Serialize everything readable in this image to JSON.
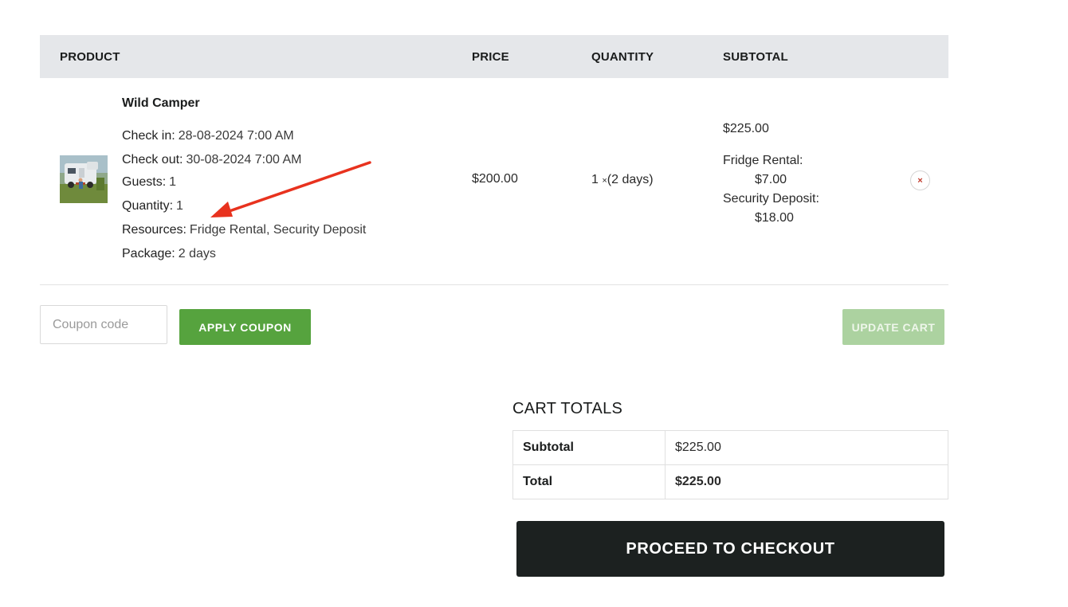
{
  "table": {
    "headers": {
      "product": "PRODUCT",
      "price": "PRICE",
      "quantity": "QUANTITY",
      "subtotal": "SUBTOTAL"
    }
  },
  "item": {
    "name": "Wild Camper",
    "meta": [
      {
        "key": "Check in:",
        "value": "28-08-2024 7:00 AM"
      },
      {
        "key": "Check out:",
        "value": "30-08-2024 7:00 AM"
      },
      {
        "key": "Guests:",
        "value": "1"
      },
      {
        "key": "Quantity:",
        "value": "1"
      },
      {
        "key": "Resources:",
        "value": "Fridge Rental, Security Deposit"
      },
      {
        "key": "Package:",
        "value": "2 days"
      }
    ],
    "price": "$200.00",
    "quantity_num": "1 ",
    "quantity_x": "×",
    "quantity_days": "(2 days)",
    "subtotal": "$225.00",
    "subtotal_lines": [
      "Fridge Rental:",
      "$7.00",
      "Security Deposit:",
      "$18.00"
    ],
    "remove_glyph": "×"
  },
  "coupon": {
    "placeholder": "Coupon code",
    "apply_label": "APPLY COUPON",
    "update_label": "UPDATE CART"
  },
  "totals": {
    "title": "CART TOTALS",
    "rows": [
      {
        "label": "Subtotal",
        "value": "$225.00"
      },
      {
        "label": "Total",
        "value": "$225.00"
      }
    ],
    "checkout_label": "PROCEED TO CHECKOUT"
  },
  "colors": {
    "accent_green": "#56a33e",
    "disabled_green": "#acd2a0",
    "checkout_dark": "#1c2120",
    "annotation_red": "#e8321e"
  }
}
